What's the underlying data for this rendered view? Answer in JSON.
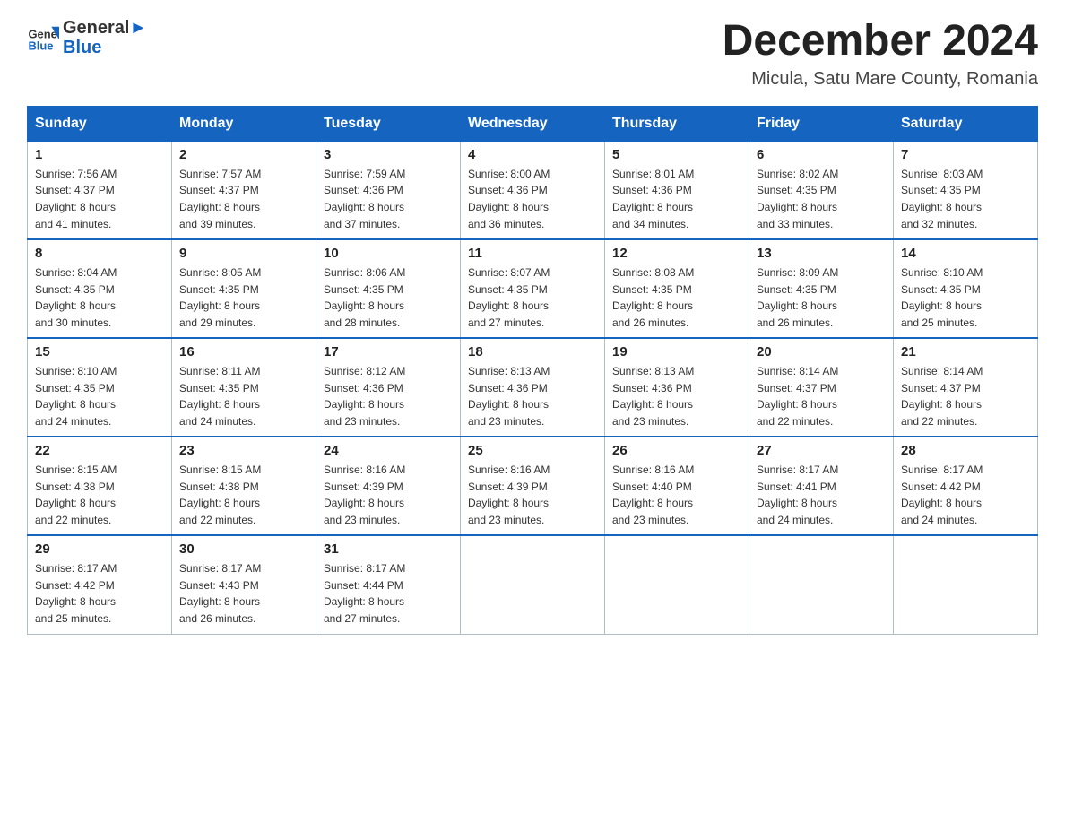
{
  "logo": {
    "text_general": "General",
    "text_blue": "Blue",
    "alt": "GeneralBlue logo"
  },
  "title": "December 2024",
  "location": "Micula, Satu Mare County, Romania",
  "days_of_week": [
    "Sunday",
    "Monday",
    "Tuesday",
    "Wednesday",
    "Thursday",
    "Friday",
    "Saturday"
  ],
  "weeks": [
    [
      {
        "day": "1",
        "sunrise": "7:56 AM",
        "sunset": "4:37 PM",
        "daylight": "8 hours and 41 minutes."
      },
      {
        "day": "2",
        "sunrise": "7:57 AM",
        "sunset": "4:37 PM",
        "daylight": "8 hours and 39 minutes."
      },
      {
        "day": "3",
        "sunrise": "7:59 AM",
        "sunset": "4:36 PM",
        "daylight": "8 hours and 37 minutes."
      },
      {
        "day": "4",
        "sunrise": "8:00 AM",
        "sunset": "4:36 PM",
        "daylight": "8 hours and 36 minutes."
      },
      {
        "day": "5",
        "sunrise": "8:01 AM",
        "sunset": "4:36 PM",
        "daylight": "8 hours and 34 minutes."
      },
      {
        "day": "6",
        "sunrise": "8:02 AM",
        "sunset": "4:35 PM",
        "daylight": "8 hours and 33 minutes."
      },
      {
        "day": "7",
        "sunrise": "8:03 AM",
        "sunset": "4:35 PM",
        "daylight": "8 hours and 32 minutes."
      }
    ],
    [
      {
        "day": "8",
        "sunrise": "8:04 AM",
        "sunset": "4:35 PM",
        "daylight": "8 hours and 30 minutes."
      },
      {
        "day": "9",
        "sunrise": "8:05 AM",
        "sunset": "4:35 PM",
        "daylight": "8 hours and 29 minutes."
      },
      {
        "day": "10",
        "sunrise": "8:06 AM",
        "sunset": "4:35 PM",
        "daylight": "8 hours and 28 minutes."
      },
      {
        "day": "11",
        "sunrise": "8:07 AM",
        "sunset": "4:35 PM",
        "daylight": "8 hours and 27 minutes."
      },
      {
        "day": "12",
        "sunrise": "8:08 AM",
        "sunset": "4:35 PM",
        "daylight": "8 hours and 26 minutes."
      },
      {
        "day": "13",
        "sunrise": "8:09 AM",
        "sunset": "4:35 PM",
        "daylight": "8 hours and 26 minutes."
      },
      {
        "day": "14",
        "sunrise": "8:10 AM",
        "sunset": "4:35 PM",
        "daylight": "8 hours and 25 minutes."
      }
    ],
    [
      {
        "day": "15",
        "sunrise": "8:10 AM",
        "sunset": "4:35 PM",
        "daylight": "8 hours and 24 minutes."
      },
      {
        "day": "16",
        "sunrise": "8:11 AM",
        "sunset": "4:35 PM",
        "daylight": "8 hours and 24 minutes."
      },
      {
        "day": "17",
        "sunrise": "8:12 AM",
        "sunset": "4:36 PM",
        "daylight": "8 hours and 23 minutes."
      },
      {
        "day": "18",
        "sunrise": "8:13 AM",
        "sunset": "4:36 PM",
        "daylight": "8 hours and 23 minutes."
      },
      {
        "day": "19",
        "sunrise": "8:13 AM",
        "sunset": "4:36 PM",
        "daylight": "8 hours and 23 minutes."
      },
      {
        "day": "20",
        "sunrise": "8:14 AM",
        "sunset": "4:37 PM",
        "daylight": "8 hours and 22 minutes."
      },
      {
        "day": "21",
        "sunrise": "8:14 AM",
        "sunset": "4:37 PM",
        "daylight": "8 hours and 22 minutes."
      }
    ],
    [
      {
        "day": "22",
        "sunrise": "8:15 AM",
        "sunset": "4:38 PM",
        "daylight": "8 hours and 22 minutes."
      },
      {
        "day": "23",
        "sunrise": "8:15 AM",
        "sunset": "4:38 PM",
        "daylight": "8 hours and 22 minutes."
      },
      {
        "day": "24",
        "sunrise": "8:16 AM",
        "sunset": "4:39 PM",
        "daylight": "8 hours and 23 minutes."
      },
      {
        "day": "25",
        "sunrise": "8:16 AM",
        "sunset": "4:39 PM",
        "daylight": "8 hours and 23 minutes."
      },
      {
        "day": "26",
        "sunrise": "8:16 AM",
        "sunset": "4:40 PM",
        "daylight": "8 hours and 23 minutes."
      },
      {
        "day": "27",
        "sunrise": "8:17 AM",
        "sunset": "4:41 PM",
        "daylight": "8 hours and 24 minutes."
      },
      {
        "day": "28",
        "sunrise": "8:17 AM",
        "sunset": "4:42 PM",
        "daylight": "8 hours and 24 minutes."
      }
    ],
    [
      {
        "day": "29",
        "sunrise": "8:17 AM",
        "sunset": "4:42 PM",
        "daylight": "8 hours and 25 minutes."
      },
      {
        "day": "30",
        "sunrise": "8:17 AM",
        "sunset": "4:43 PM",
        "daylight": "8 hours and 26 minutes."
      },
      {
        "day": "31",
        "sunrise": "8:17 AM",
        "sunset": "4:44 PM",
        "daylight": "8 hours and 27 minutes."
      },
      null,
      null,
      null,
      null
    ]
  ],
  "labels": {
    "sunrise": "Sunrise:",
    "sunset": "Sunset:",
    "daylight": "Daylight:"
  }
}
